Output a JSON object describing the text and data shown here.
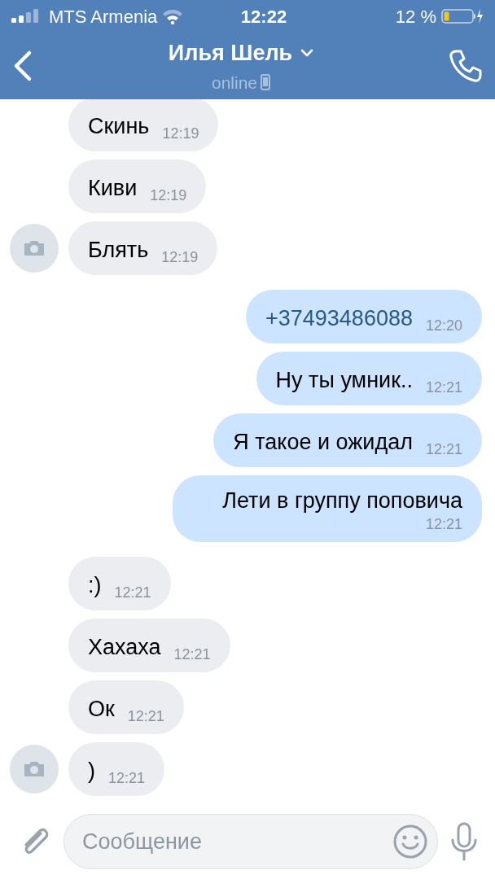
{
  "status_bar": {
    "carrier": "MTS Armenia",
    "time": "12:22",
    "battery": "12 %"
  },
  "header": {
    "title": "Илья Шель",
    "status": "online"
  },
  "messages": [
    {
      "kind": "in",
      "text": "Скинь",
      "time": "12:19",
      "avatar": false,
      "link": false
    },
    {
      "kind": "in",
      "text": "Киви",
      "time": "12:19",
      "avatar": false,
      "link": false
    },
    {
      "kind": "in",
      "text": "Блять",
      "time": "12:19",
      "avatar": true,
      "link": false
    },
    {
      "kind": "out",
      "text": "+37493486088",
      "time": "12:20",
      "avatar": false,
      "link": true
    },
    {
      "kind": "out",
      "text": "Ну ты умник..",
      "time": "12:21",
      "avatar": false,
      "link": false
    },
    {
      "kind": "out",
      "text": "Я такое и ожидал",
      "time": "12:21",
      "avatar": false,
      "link": false
    },
    {
      "kind": "out",
      "text": "Лети в группу поповича",
      "time": "12:21",
      "avatar": false,
      "link": false
    },
    {
      "kind": "in",
      "text": ":)",
      "time": "12:21",
      "avatar": false,
      "link": false
    },
    {
      "kind": "in",
      "text": "Хахаха",
      "time": "12:21",
      "avatar": false,
      "link": false
    },
    {
      "kind": "in",
      "text": "Ок",
      "time": "12:21",
      "avatar": false,
      "link": false
    },
    {
      "kind": "in",
      "text": ")",
      "time": "12:21",
      "avatar": true,
      "link": false
    }
  ],
  "composer": {
    "placeholder": "Сообщение"
  }
}
